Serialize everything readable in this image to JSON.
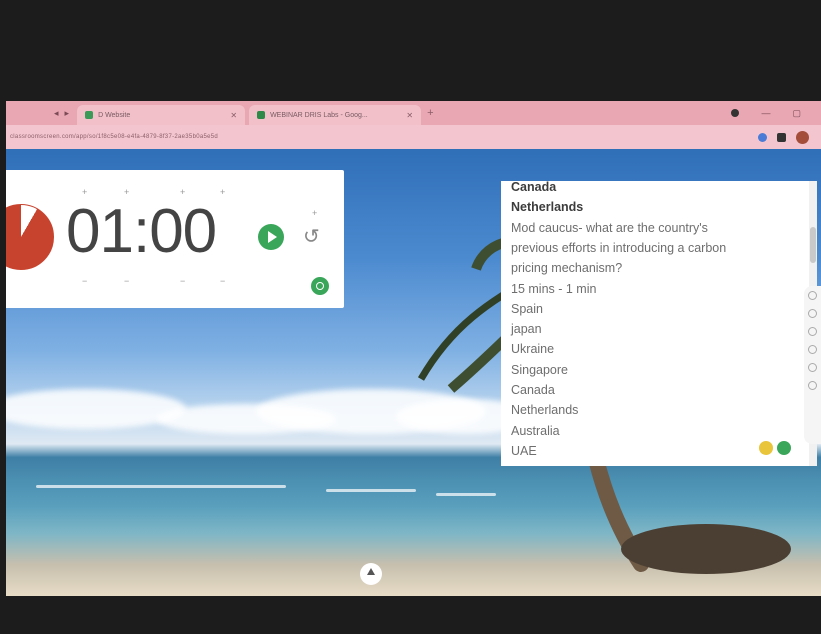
{
  "browser": {
    "tabs": [
      {
        "label": "D Website"
      },
      {
        "label": "WEBINAR DRIS Labs - Goog..."
      }
    ],
    "url": "classroomscreen.com/app/so/1f8c5e08-e4fa-4879-8f37-2ae35b0a5e5d"
  },
  "timer": {
    "display": "01:00"
  },
  "notes": {
    "lines": [
      {
        "text": "Canada",
        "bold": true
      },
      {
        "text": "Netherlands",
        "bold": true
      },
      {
        "text": "Mod caucus- what are the country's",
        "bold": false
      },
      {
        "text": "previous efforts in introducing a carbon",
        "bold": false
      },
      {
        "text": "pricing mechanism?",
        "bold": false
      },
      {
        "text": "15 mins - 1 min",
        "bold": false
      },
      {
        "text": "Spain",
        "bold": false
      },
      {
        "text": "japan",
        "bold": false
      },
      {
        "text": "Ukraine",
        "bold": false
      },
      {
        "text": "Singapore",
        "bold": false
      },
      {
        "text": "Canada",
        "bold": false
      },
      {
        "text": "Netherlands",
        "bold": false
      },
      {
        "text": "Australia",
        "bold": false
      },
      {
        "text": "UAE",
        "bold": false
      }
    ]
  },
  "colors": {
    "tab_bar": "#e8a7b3",
    "timer_pie": "#c8432e",
    "accent_green": "#3aa65a"
  },
  "icons": {
    "play": "play-icon",
    "reset": "reset-icon",
    "up": "arrow-up-icon"
  }
}
